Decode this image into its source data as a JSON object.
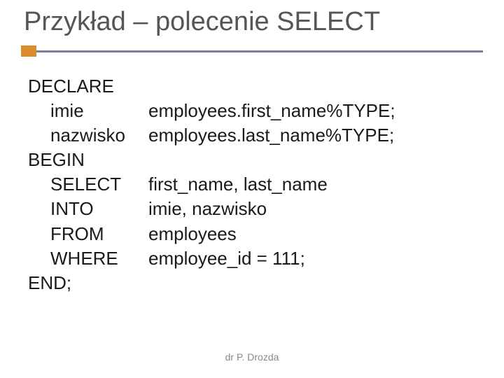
{
  "title": "Przykład – polecenie SELECT",
  "code": {
    "l1": "DECLARE",
    "l2a": "imie",
    "l2b": "employees.first_name%TYPE;",
    "l3a": "nazwisko",
    "l3b": "employees.last_name%TYPE;",
    "l4": "BEGIN",
    "l5a": "SELECT",
    "l5b": "first_name, last_name",
    "l6a": "INTO",
    "l6b": "imie, nazwisko",
    "l7a": "FROM",
    "l7b": "employees",
    "l8a": "WHERE",
    "l8b": "employee_id = 111;",
    "l9": "END;"
  },
  "footer": "dr P. Drozda"
}
